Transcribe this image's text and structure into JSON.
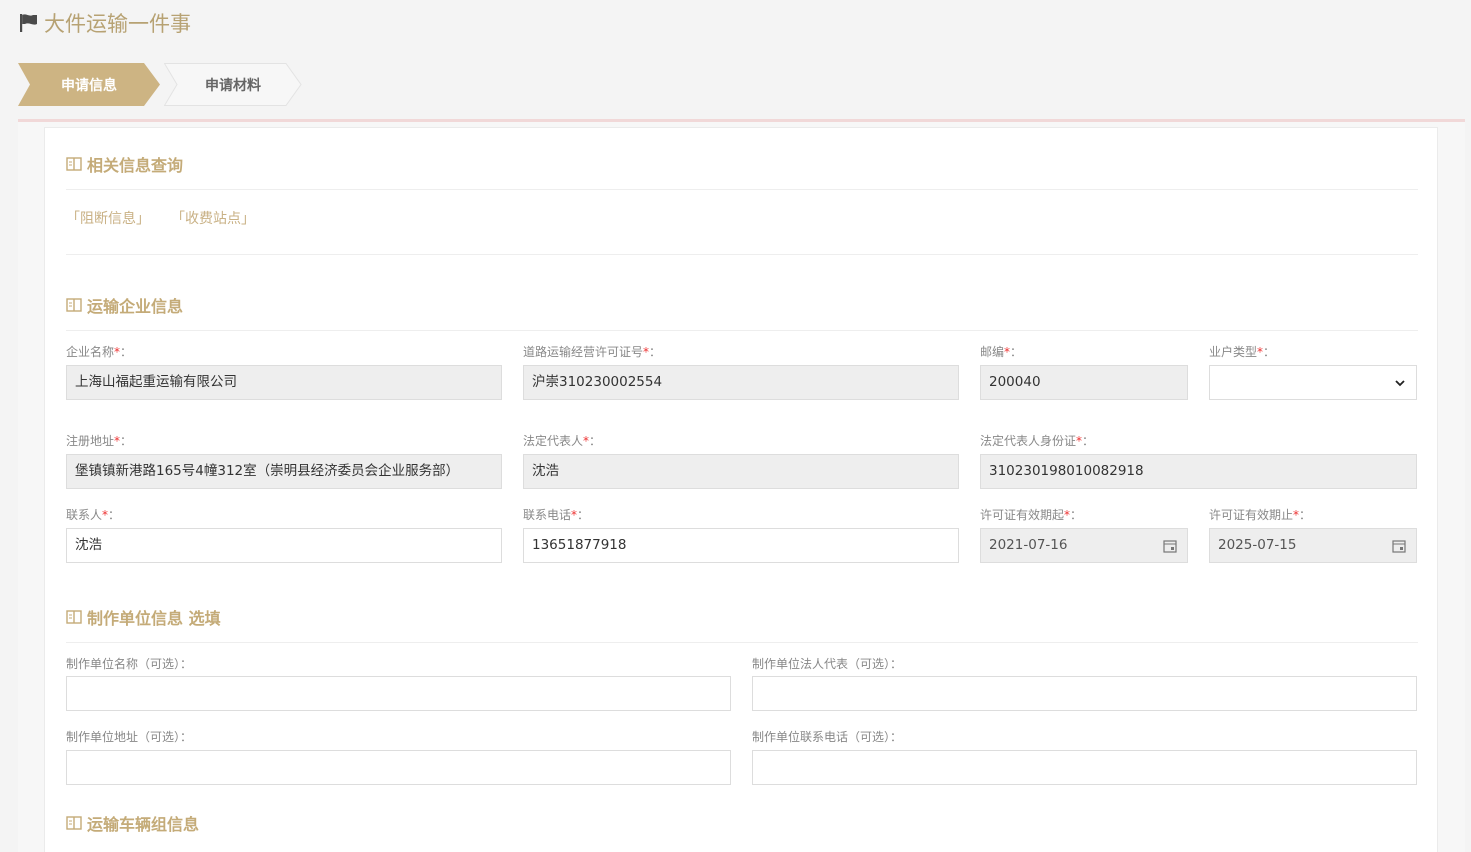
{
  "header": {
    "title": "大件运输一件事"
  },
  "steps": [
    {
      "label": "申请信息"
    },
    {
      "label": "申请材料"
    }
  ],
  "sections": {
    "related_query": "相关信息查询",
    "enterprise": "运输企业信息",
    "producer": "制作单位信息 选填",
    "vehicle_group": "运输车辆组信息"
  },
  "links": {
    "blocking": "「阻断信息」",
    "toll": "「收费站点」"
  },
  "enterprise": {
    "company_name": {
      "label": "企业名称",
      "value": "上海山福起重运输有限公司"
    },
    "license_no": {
      "label": "道路运输经营许可证号",
      "value": "沪崇310230002554"
    },
    "postcode": {
      "label": "邮编",
      "value": "200040"
    },
    "household_type": {
      "label": "业户类型",
      "value": ""
    },
    "reg_address": {
      "label": "注册地址",
      "value": "堡镇镇新港路165号4幢312室（崇明县经济委员会企业服务部）"
    },
    "legal_rep": {
      "label": "法定代表人",
      "value": "沈浩"
    },
    "legal_rep_id": {
      "label": "法定代表人身份证",
      "value": "310230198010082918"
    },
    "contact": {
      "label": "联系人",
      "value": "沈浩"
    },
    "contact_phone": {
      "label": "联系电话",
      "value": "13651877918"
    },
    "valid_from": {
      "label": "许可证有效期起",
      "value": "2021-07-16"
    },
    "valid_to": {
      "label": "许可证有效期止",
      "value": "2025-07-15"
    }
  },
  "producer": {
    "name_label": "制作单位名称（可选）：",
    "legal_label": "制作单位法人代表（可选）：",
    "address_label": "制作单位地址（可选）：",
    "phone_label": "制作单位联系电话（可选）："
  },
  "required_mark": "*",
  "label_suffix": "："
}
